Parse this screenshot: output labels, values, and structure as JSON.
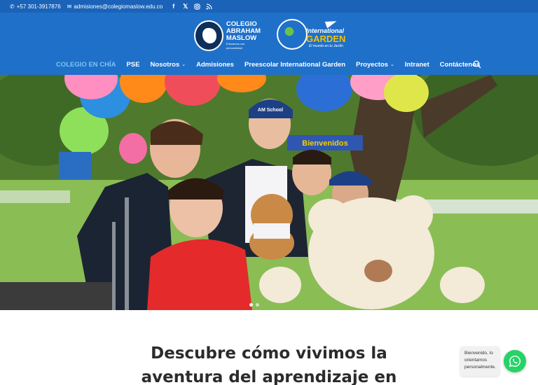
{
  "topbar": {
    "phone": "+57 301-3917876",
    "email": "admisiones@colegiomaslow.edu.co",
    "social_icons": [
      "facebook-icon",
      "x-icon",
      "instagram-icon",
      "rss-icon"
    ]
  },
  "header": {
    "logo_am": {
      "line1": "COLEGIO",
      "line2": "ABRAHAM",
      "line3": "MASLOW",
      "tagline": "Educamos con personalidad"
    },
    "logo_ig": {
      "line1": "International",
      "line2": "GARDEN",
      "tagline": "El mundo en tu Jardín"
    },
    "colors": {
      "header_bg": "#1f70c9",
      "topbar_bg": "#1a63b8",
      "active_nav": "#7cc4f4"
    }
  },
  "nav": {
    "items": [
      {
        "label": "COLEGIO EN CHÍA",
        "active": true,
        "dropdown": false
      },
      {
        "label": "PSE",
        "active": false,
        "dropdown": false
      },
      {
        "label": "Nosotros",
        "active": false,
        "dropdown": true
      },
      {
        "label": "Admisiones",
        "active": false,
        "dropdown": false
      },
      {
        "label": "Preescolar International Garden",
        "active": false,
        "dropdown": false
      },
      {
        "label": "Proyectos",
        "active": false,
        "dropdown": true
      },
      {
        "label": "Intranet",
        "active": false,
        "dropdown": false
      },
      {
        "label": "Contáctenos",
        "active": false,
        "dropdown": false
      }
    ]
  },
  "hero": {
    "banner_text": "Bienvenidos",
    "cap_text": "AM School"
  },
  "main": {
    "heading_line1": "Descubre cómo vivimos la",
    "heading_line2": "aventura del aprendizaje en"
  },
  "chat": {
    "line1": "Bienvenido, lo",
    "line2": "orientamos",
    "line3": "personalmente."
  }
}
